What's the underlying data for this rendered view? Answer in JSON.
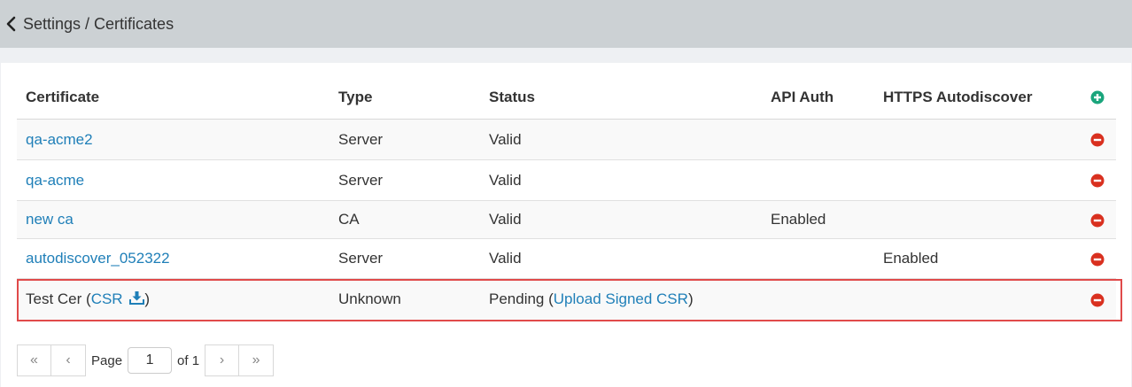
{
  "breadcrumb": "Settings / Certificates",
  "columns": {
    "certificate": "Certificate",
    "type": "Type",
    "status": "Status",
    "api_auth": "API Auth",
    "https_autodiscover": "HTTPS Autodiscover"
  },
  "rows": [
    {
      "name": "qa-acme2",
      "type": "Server",
      "status": "Valid",
      "api_auth": "",
      "https_autodiscover": ""
    },
    {
      "name": "qa-acme",
      "type": "Server",
      "status": "Valid",
      "api_auth": "",
      "https_autodiscover": ""
    },
    {
      "name": "new ca",
      "type": "CA",
      "status": "Valid",
      "api_auth": "Enabled",
      "https_autodiscover": ""
    },
    {
      "name": "autodiscover_052322",
      "type": "Server",
      "status": "Valid",
      "api_auth": "",
      "https_autodiscover": "Enabled"
    }
  ],
  "pending_row": {
    "name": "Test Cer",
    "open_paren": " (",
    "csr_label": "CSR",
    "close_paren": ")",
    "type": "Unknown",
    "status": "Pending",
    "status_open": " (",
    "upload_label": "Upload Signed CSR",
    "status_close": ")"
  },
  "pager": {
    "first": "«",
    "prev": "‹",
    "page_label": "Page",
    "current_page": "1",
    "of_label": "of 1",
    "next": "›",
    "last": "»"
  },
  "colors": {
    "topbar": "#ccd1d4",
    "link": "#1f7fb8",
    "add": "#1aa57c",
    "remove": "#d9301f",
    "highlight": "#e04a4a"
  },
  "icons": {
    "back": "chevron-left-icon",
    "add": "plus-circle-icon",
    "remove": "minus-circle-icon",
    "download": "download-icon"
  }
}
